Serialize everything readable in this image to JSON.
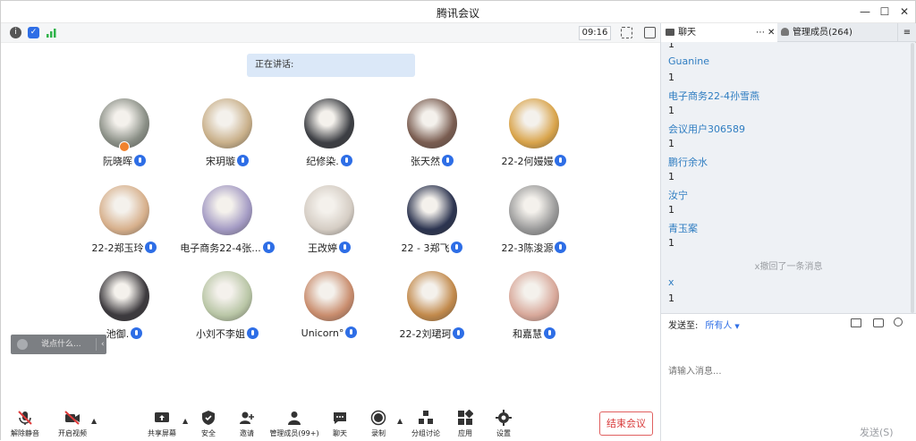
{
  "window": {
    "title": "腾讯会议"
  },
  "topbar": {
    "time": "09:16"
  },
  "main": {
    "speaking_label": "正在讲话:"
  },
  "participants": [
    {
      "name": "阮晓晖",
      "host": true,
      "color": "#8a8f86"
    },
    {
      "name": "宋玥璇",
      "host": false,
      "color": "#c9b08a"
    },
    {
      "name": "纪修染.",
      "host": false,
      "color": "#3d3f44"
    },
    {
      "name": "张天然",
      "host": false,
      "color": "#7a5d51"
    },
    {
      "name": "22-2何嫚嫚",
      "host": false,
      "color": "#d9a44b"
    },
    {
      "name": "22-2郑玉玲",
      "host": false,
      "color": "#d7b08c"
    },
    {
      "name": "电子商务22-4张...",
      "host": false,
      "color": "#a49bc4"
    },
    {
      "name": "王改婷",
      "host": false,
      "color": "#d5cdc4"
    },
    {
      "name": "22 - 3郑飞",
      "host": false,
      "color": "#2c3450"
    },
    {
      "name": "22-3陈浚源",
      "host": false,
      "color": "#9a9a9a"
    },
    {
      "name": "池御.",
      "host": false,
      "color": "#3d3a3e"
    },
    {
      "name": "小刘不李姐",
      "host": false,
      "color": "#b9c6a6"
    },
    {
      "name": "Unicorn°",
      "host": false,
      "color": "#c98d6e"
    },
    {
      "name": "22-2刘珺珂",
      "host": false,
      "color": "#c28a4c"
    },
    {
      "name": "和嘉慧",
      "host": false,
      "color": "#d8a89a"
    }
  ],
  "chat_input_mini": {
    "placeholder": "说点什么..."
  },
  "toolbar": {
    "unmute": "解除静音",
    "video": "开启视频",
    "share": "共享屏幕",
    "security": "安全",
    "invite": "邀请",
    "members": "管理成员(99+)",
    "chat": "聊天",
    "record": "录制",
    "breakout": "分组讨论",
    "apps": "应用",
    "settings": "设置",
    "end": "结束会议"
  },
  "sidebar": {
    "tab_chat": "聊天",
    "tab_members": "管理成员(264)",
    "messages": [
      {
        "text": "1"
      },
      {
        "user": "Guanine",
        "text": "1"
      },
      {
        "user": "电子商务22-4孙雪燕",
        "text": "1"
      },
      {
        "user": "会议用户306589",
        "text": "1"
      },
      {
        "user": "鹏行余水",
        "text": "1"
      },
      {
        "user": "汝宁",
        "text": "1"
      },
      {
        "user": "青玉案",
        "text": "1"
      },
      {
        "system": "x撤回了一条消息"
      },
      {
        "user": "x",
        "text": "1"
      }
    ],
    "send_to_label": "发送至:",
    "send_to_value": "所有人",
    "input_placeholder": "请输入消息...",
    "send_button": "发送(S)"
  },
  "colors": {
    "accent": "#2e6ee6",
    "end": "#d83b3b",
    "chat_user": "#2f7dc1"
  }
}
